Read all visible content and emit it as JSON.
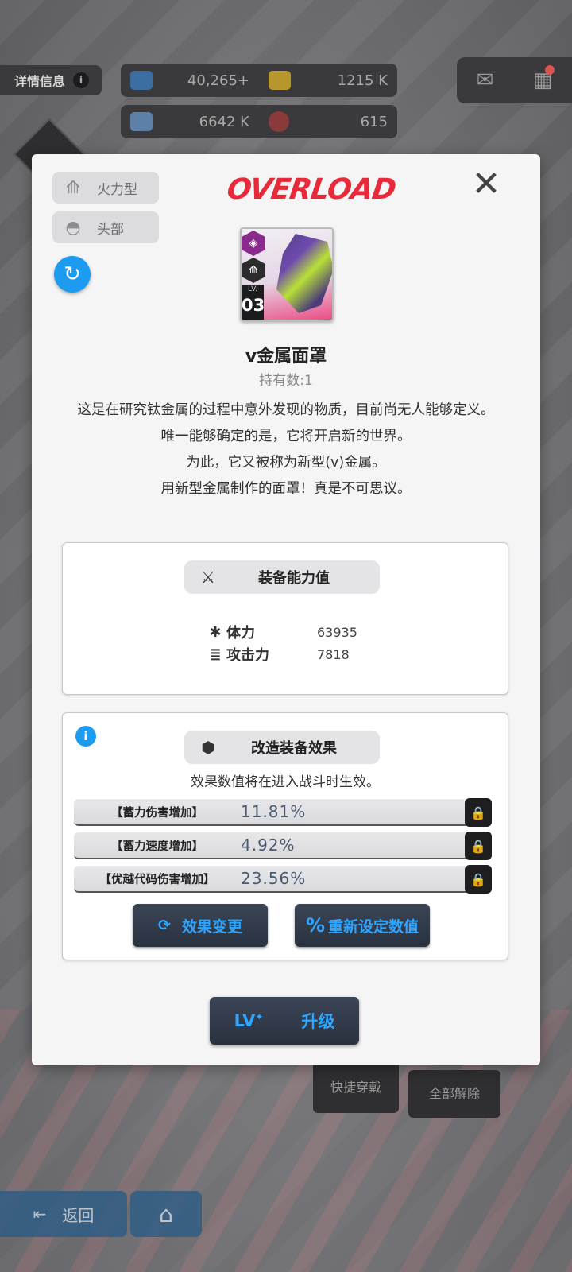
{
  "background": {
    "detail_label": "详情信息",
    "info_icon": "i",
    "resources": [
      {
        "icon": "crystal-icon",
        "value": "40,265",
        "suffix": "+"
      },
      {
        "icon": "battery-icon",
        "value": "1215 K"
      },
      {
        "icon": "weapon-core-icon",
        "value": "6642 K"
      },
      {
        "icon": "core-icon",
        "value": "615"
      }
    ],
    "buttons": {
      "quick_equip": "快捷穿戴",
      "remove_all": "全部解除",
      "back": "返回"
    }
  },
  "modal": {
    "brand": "OVERLOAD",
    "tags": [
      {
        "icon": "firepower-icon",
        "label": "火力型"
      },
      {
        "icon": "helmet-icon",
        "label": "头部"
      }
    ],
    "item": {
      "level_label": "LV.",
      "level": "03",
      "name": "v金属面罩",
      "count_text": "持有数:1"
    },
    "description": [
      "这是在研究钛金属的过程中意外发现的物质，目前尚无人能够定义。",
      "唯一能够确定的是，它将开启新的世界。",
      "为此，它又被称为新型(v)金属。",
      "用新型金属制作的面罩！真是不可思议。"
    ],
    "stats_panel": {
      "title": "装备能力值",
      "stats": [
        {
          "icon": "hp-icon",
          "glyph": "✱",
          "label": "体力",
          "value": "63935"
        },
        {
          "icon": "attack-icon",
          "glyph": "≣",
          "label": "攻击力",
          "value": "7818"
        }
      ]
    },
    "effects_panel": {
      "title": "改造装备效果",
      "note": "效果数值将在进入战斗时生效。",
      "effects": [
        {
          "name": "【蓄力伤害增加】",
          "value": "11.81%"
        },
        {
          "name": "【蓄力速度增加】",
          "value": "4.92%"
        },
        {
          "name": "【优越代码伤害增加】",
          "value": "23.56%"
        }
      ],
      "change_label": "效果变更",
      "reset_label": "重新设定数值"
    },
    "upgrade": {
      "lv_label": "LV",
      "label": "升级"
    }
  },
  "colors": {
    "accent_blue": "#2ea6ff",
    "brand_red": "#e8293a",
    "rarity_purple": "#8a2a8d"
  }
}
